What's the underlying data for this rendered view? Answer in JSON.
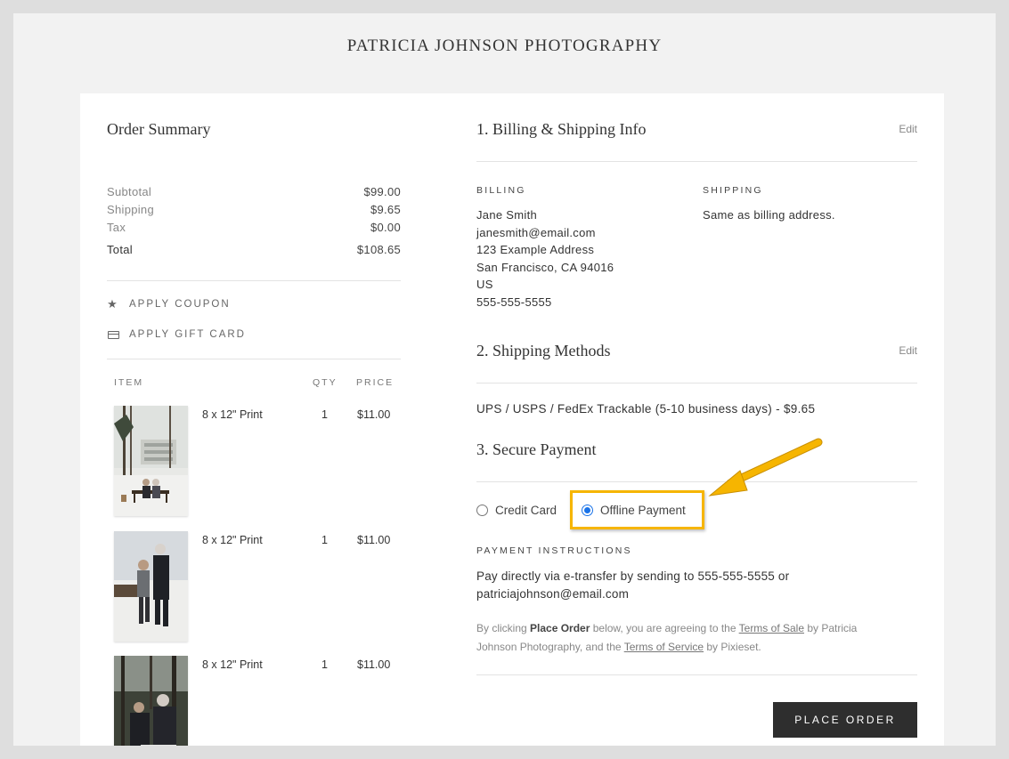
{
  "brand": "PATRICIA JOHNSON PHOTOGRAPHY",
  "order_summary": {
    "title": "Order Summary",
    "subtotal_label": "Subtotal",
    "subtotal": "$99.00",
    "shipping_label": "Shipping",
    "shipping": "$9.65",
    "tax_label": "Tax",
    "tax": "$0.00",
    "total_label": "Total",
    "total": "$108.65",
    "apply_coupon": "APPLY COUPON",
    "apply_gift_card": "APPLY GIFT CARD",
    "headers": {
      "item": "ITEM",
      "qty": "QTY",
      "price": "PRICE"
    },
    "items": [
      {
        "name": "8 x 12\" Print",
        "qty": "1",
        "price": "$11.00"
      },
      {
        "name": "8 x 12\" Print",
        "qty": "1",
        "price": "$11.00"
      },
      {
        "name": "8 x 12\" Print",
        "qty": "1",
        "price": "$11.00"
      }
    ]
  },
  "billing_section": {
    "title": "1. Billing & Shipping Info",
    "edit": "Edit",
    "billing_label": "BILLING",
    "shipping_label": "SHIPPING",
    "billing_lines": [
      "Jane Smith",
      "janesmith@email.com",
      "123 Example Address",
      "San Francisco, CA 94016",
      "US",
      "555-555-5555"
    ],
    "shipping_text": "Same as billing address."
  },
  "shipping_methods": {
    "title": "2. Shipping Methods",
    "edit": "Edit",
    "method": "UPS / USPS / FedEx Trackable (5-10 business days) - $9.65"
  },
  "payment": {
    "title": "3. Secure Payment",
    "option_credit": "Credit Card",
    "option_offline": "Offline Payment",
    "selected": "Offline Payment",
    "instructions_label": "PAYMENT INSTRUCTIONS",
    "instructions": "Pay directly via e-transfer by sending to 555-555-5555 or patriciajohnson@email.com",
    "legal": {
      "p1": "By clicking ",
      "bold": "Place Order",
      "p2": " below, you are agreeing to the ",
      "link1": "Terms of Sale",
      "p3": " by Patricia Johnson Photography, and the ",
      "link2": "Terms of Service",
      "p4": " by Pixieset."
    },
    "place_order": "PLACE ORDER"
  },
  "colors": {
    "accent_highlight": "#f6b500",
    "button": "#2e2e2e",
    "radio_selected": "#1a73e8"
  }
}
